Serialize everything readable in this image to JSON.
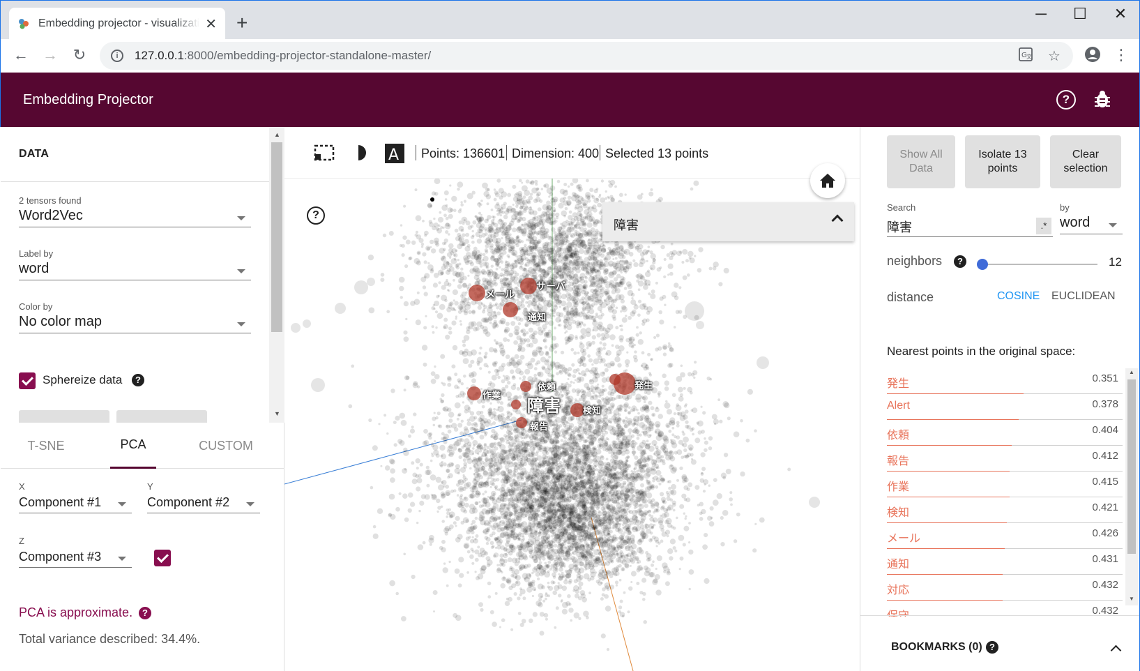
{
  "browser": {
    "tab_title": "Embedding projector - visualization",
    "url_host": "127.0.0.1",
    "url_rest": ":8000/embedding-projector-standalone-master/"
  },
  "app": {
    "title": "Embedding Projector"
  },
  "data_panel": {
    "title": "DATA",
    "tensors_label": "2 tensors found",
    "tensor_value": "Word2Vec",
    "label_by_label": "Label by",
    "label_by_value": "word",
    "color_by_label": "Color by",
    "color_by_value": "No color map",
    "sphereize_label": "Sphereize data",
    "sphereize_checked": true
  },
  "projection_tabs": [
    {
      "label": "T-SNE",
      "active": false
    },
    {
      "label": "PCA",
      "active": true
    },
    {
      "label": "CUSTOM",
      "active": false
    }
  ],
  "pca": {
    "x_label": "X",
    "x_value": "Component #1",
    "y_label": "Y",
    "y_value": "Component #2",
    "z_label": "Z",
    "z_value": "Component #3",
    "z_enabled": true,
    "warning": "PCA is approximate.",
    "variance": "Total variance described: 34.4%."
  },
  "stats": {
    "points": "Points: 136601",
    "dimension": "Dimension: 400",
    "selected": "Selected 13 points"
  },
  "search_popup": {
    "label": "障害"
  },
  "point_labels": {
    "main": "障害",
    "mail": "メール",
    "server": "サーバ",
    "notify": "通知",
    "request": "依頼",
    "work": "作業",
    "detect": "検知",
    "report": "報告",
    "occur": "発生"
  },
  "inspector": {
    "show_all": "Show All Data",
    "isolate": "Isolate 13 points",
    "clear": "Clear selection",
    "search_label": "Search",
    "search_value": "障害",
    "regex_label": ".*",
    "by_label": "by",
    "by_value": "word",
    "neighbors_label": "neighbors",
    "neighbors_value": "12",
    "distance_label": "distance",
    "cosine": "COSINE",
    "euclidean": "EUCLIDEAN",
    "nn_title": "Nearest points in the original space:",
    "neighbors": [
      {
        "label": "発生",
        "value": "0.351"
      },
      {
        "label": "Alert",
        "value": "0.378"
      },
      {
        "label": "依頼",
        "value": "0.404"
      },
      {
        "label": "報告",
        "value": "0.412"
      },
      {
        "label": "作業",
        "value": "0.415"
      },
      {
        "label": "検知",
        "value": "0.421"
      },
      {
        "label": "メール",
        "value": "0.426"
      },
      {
        "label": "通知",
        "value": "0.431"
      },
      {
        "label": "対応",
        "value": "0.432"
      },
      {
        "label": "保守",
        "value": "0.432"
      }
    ],
    "bookmarks": "BOOKMARKS (0)"
  },
  "colors": {
    "header": "#560731",
    "accent": "#880e4f",
    "neighbor": "#e8735a",
    "link": "#2196f3"
  }
}
